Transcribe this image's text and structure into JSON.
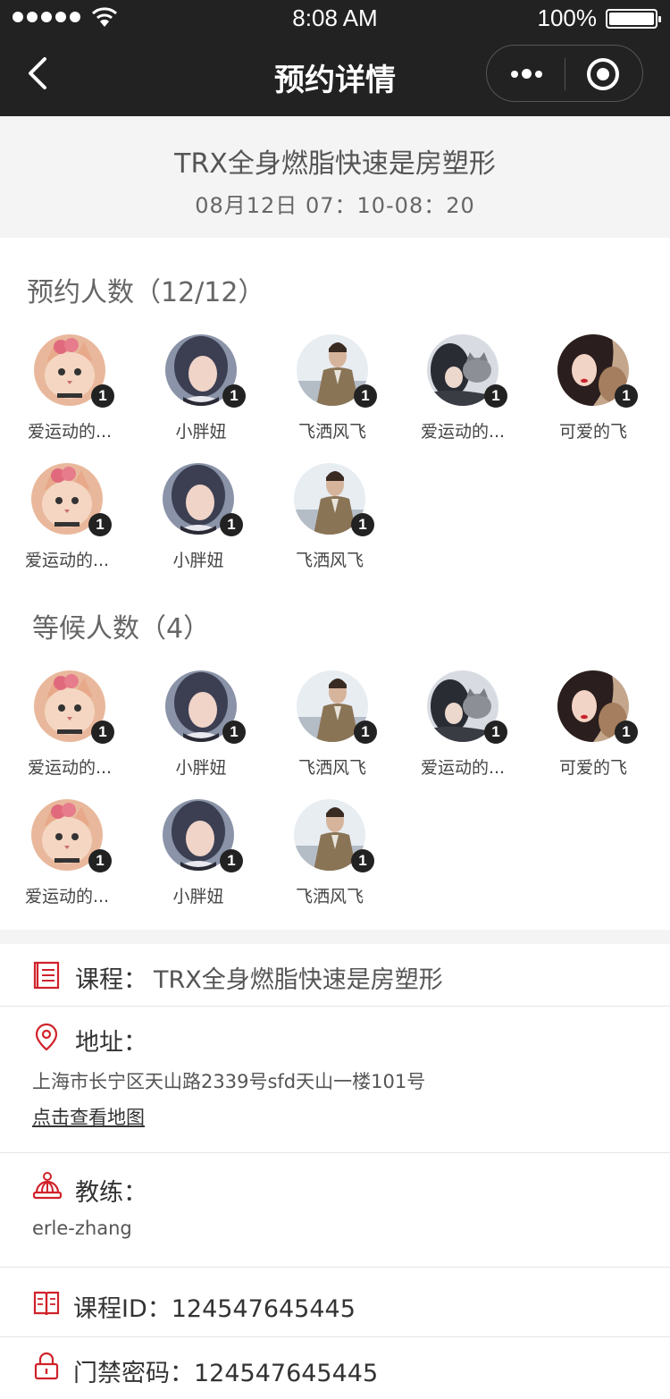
{
  "status_bar": {
    "time": "8:08 AM",
    "battery": "100%"
  },
  "nav": {
    "title": "预约详情"
  },
  "course": {
    "title": "TRX全身燃脂快速是房塑形",
    "time": "08月12日 07：10-08：20"
  },
  "booked": {
    "title": "预约人数（12/12）",
    "members": [
      {
        "name": "爱运动的...",
        "count": "1",
        "avatar": "cat"
      },
      {
        "name": "小胖妞",
        "count": "1",
        "avatar": "girl"
      },
      {
        "name": "飞洒风飞",
        "count": "1",
        "avatar": "man"
      },
      {
        "name": "爱运动的...",
        "count": "1",
        "avatar": "girl-cat"
      },
      {
        "name": "可爱的飞",
        "count": "1",
        "avatar": "woman"
      },
      {
        "name": "爱运动的...",
        "count": "1",
        "avatar": "cat"
      },
      {
        "name": "小胖妞",
        "count": "1",
        "avatar": "girl"
      },
      {
        "name": "飞洒风飞",
        "count": "1",
        "avatar": "man"
      }
    ]
  },
  "waiting": {
    "title": "等候人数（4）",
    "members": [
      {
        "name": "爱运动的...",
        "count": "1",
        "avatar": "cat"
      },
      {
        "name": "小胖妞",
        "count": "1",
        "avatar": "girl"
      },
      {
        "name": "飞洒风飞",
        "count": "1",
        "avatar": "man"
      },
      {
        "name": "爱运动的...",
        "count": "1",
        "avatar": "girl-cat"
      },
      {
        "name": "可爱的飞",
        "count": "1",
        "avatar": "woman"
      },
      {
        "name": "爱运动的...",
        "count": "1",
        "avatar": "cat"
      },
      {
        "name": "小胖妞",
        "count": "1",
        "avatar": "girl"
      },
      {
        "name": "飞洒风飞",
        "count": "1",
        "avatar": "man"
      }
    ]
  },
  "details": {
    "course_label": "课程：",
    "course_value": "TRX全身燃脂快速是房塑形",
    "address_label": "地址：",
    "address_value": "上海市长宁区天山路2339号sfd天山一楼101号",
    "map_link": "点击查看地图",
    "coach_label": "教练：",
    "coach_value": "erle-zhang",
    "course_id": "课程ID：124547645445",
    "door_code": "门禁密码：124547645445"
  },
  "colors": {
    "accent": "#d0222a",
    "topbar": "#222222",
    "section_bg": "#f4f4f4"
  },
  "icons": [
    "signal-icon",
    "wifi-icon",
    "battery-icon",
    "back-icon",
    "more-icon",
    "close-miniprogram-icon",
    "document-icon",
    "location-pin-icon",
    "coach-icon",
    "book-icon",
    "lock-icon"
  ]
}
